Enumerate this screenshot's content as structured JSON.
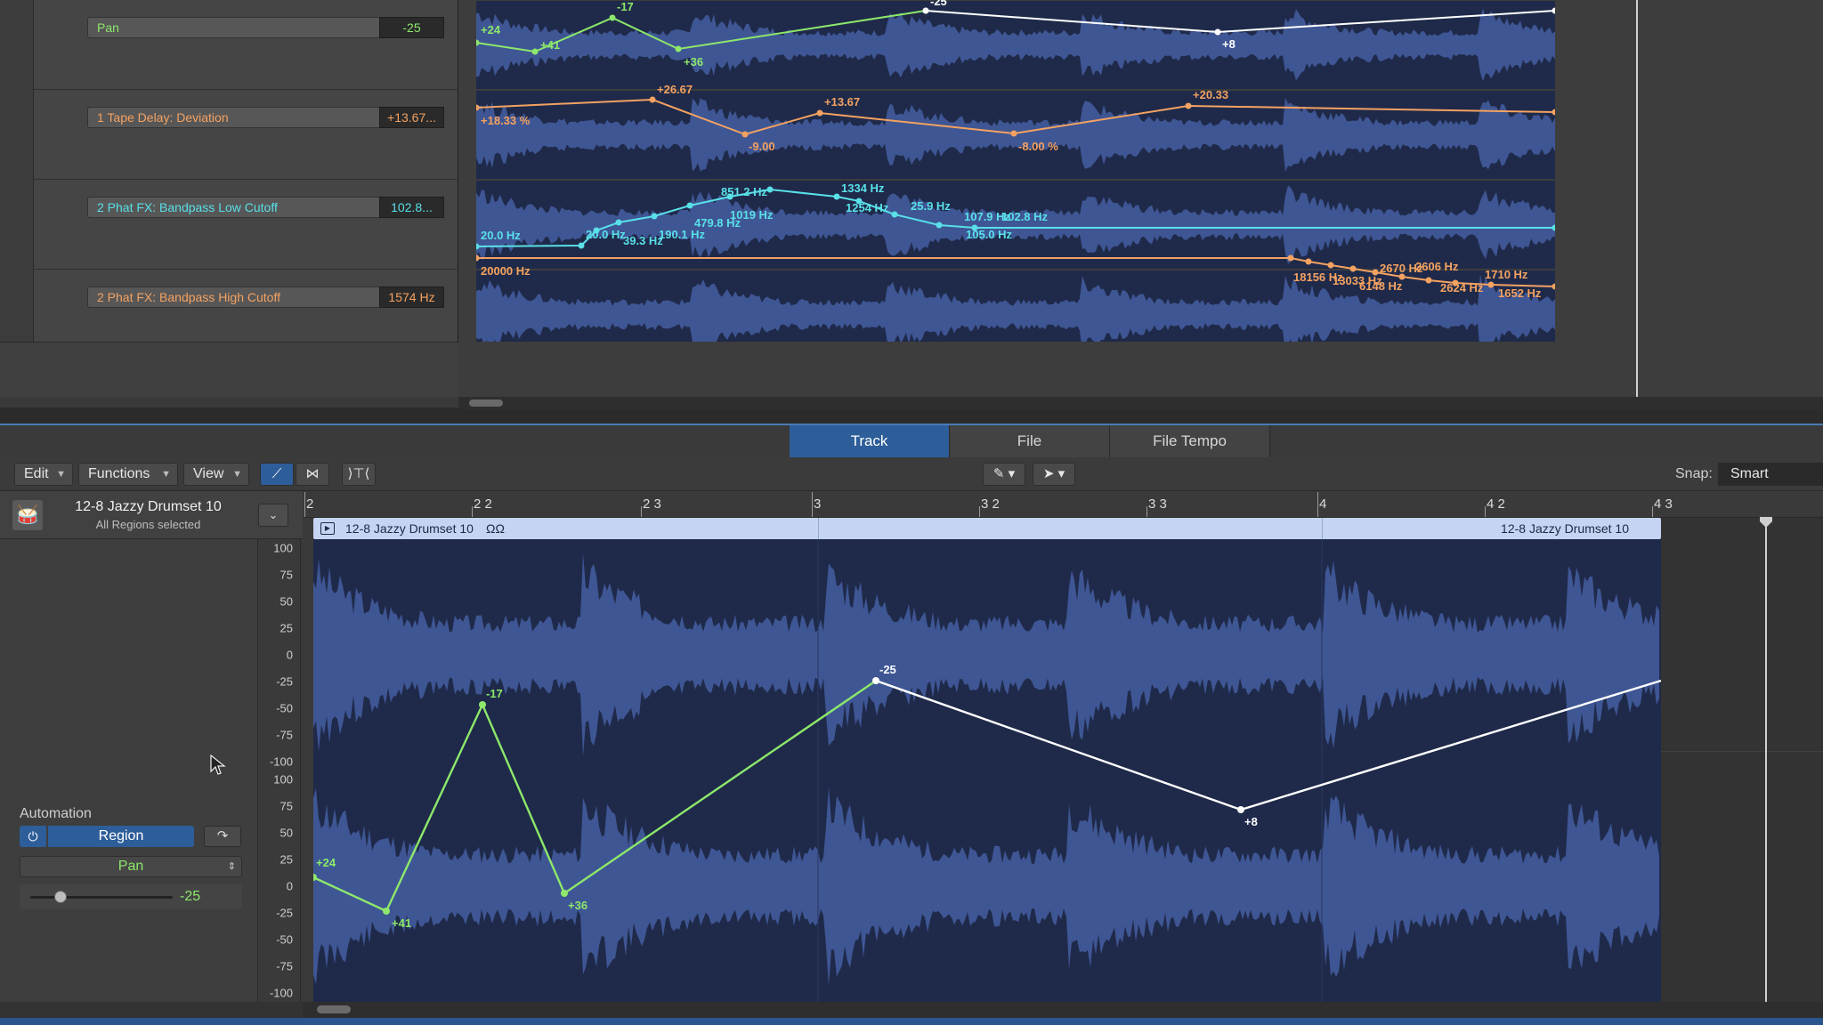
{
  "upper_lanes": [
    {
      "param": "Pan",
      "value": "-25",
      "color": "#8de86b"
    },
    {
      "param": "1 Tape Delay: Deviation",
      "value": "+13.67...",
      "color": "#f4a261"
    },
    {
      "param": "2 Phat FX: Bandpass Low Cutoff",
      "value": "102.8...",
      "color": "#59e0e8"
    },
    {
      "param": "2 Phat FX: Bandpass High Cutoff",
      "value": "1574 Hz",
      "color": "#f4a261"
    }
  ],
  "lane_labels": {
    "pan": [
      "+24",
      "+41",
      "-17",
      "+36",
      "-25",
      "+8"
    ],
    "deviation": [
      "+18.33 %",
      "+26.67",
      "-9.00",
      "+13.67",
      "-8.00 %",
      "+20.33"
    ],
    "low_cutoff": [
      "20.0 Hz",
      "20.0 Hz",
      "39.3 Hz",
      "190.1 Hz",
      "479.8 Hz",
      "851.2 Hz",
      "1019 Hz",
      "1334 Hz",
      "1254 Hz",
      "25.9 Hz",
      "107.9 Hz",
      "102.8 Hz",
      "105.0 Hz"
    ],
    "high_cutoff": [
      "20000 Hz",
      "18156 Hz",
      "13033 Hz",
      "6148 Hz",
      "2670 Hz",
      "2606 Hz",
      "2624 Hz",
      "1710 Hz",
      "1652 Hz"
    ]
  },
  "editor": {
    "tabs": [
      {
        "label": "Track",
        "active": true
      },
      {
        "label": "File",
        "active": false
      },
      {
        "label": "File Tempo",
        "active": false
      }
    ],
    "menus": [
      "Edit",
      "Functions",
      "View"
    ],
    "snap_label": "Snap:",
    "snap_value": "Smart",
    "region_title": "12-8 Jazzy Drumset 10",
    "region_subtitle": "All Regions selected",
    "automation": {
      "label": "Automation",
      "mode": "Region",
      "param": "Pan",
      "value_label": "-25",
      "value": -25
    },
    "ruler": [
      "2",
      "2 2",
      "2 3",
      "3",
      "3 2",
      "3 3",
      "4",
      "4 2",
      "4 3"
    ],
    "region_bar": {
      "name_left": "12-8 Jazzy Drumset 10",
      "loop_icon": "ΩΩ",
      "name_right": "12-8 Jazzy Drumset 10"
    },
    "scale_top": [
      "100",
      "75",
      "50",
      "25",
      "0",
      "-25",
      "-50",
      "-75",
      "-100"
    ],
    "scale_bottom": [
      "100",
      "75",
      "50",
      "25",
      "0",
      "-25",
      "-50",
      "-75",
      "-100"
    ],
    "points": [
      {
        "label": "+24"
      },
      {
        "label": "+41"
      },
      {
        "label": "-17"
      },
      {
        "label": "+36"
      },
      {
        "label": "-25"
      },
      {
        "label": "+8"
      }
    ]
  },
  "colors": {
    "pan": "#8de86b",
    "pan_after": "#ffffff",
    "orange": "#f4a261",
    "cyan": "#59e0e8",
    "waveform_bg": "#1f2a4a",
    "waveform": "#3f5694",
    "accent": "#2e5e99"
  }
}
